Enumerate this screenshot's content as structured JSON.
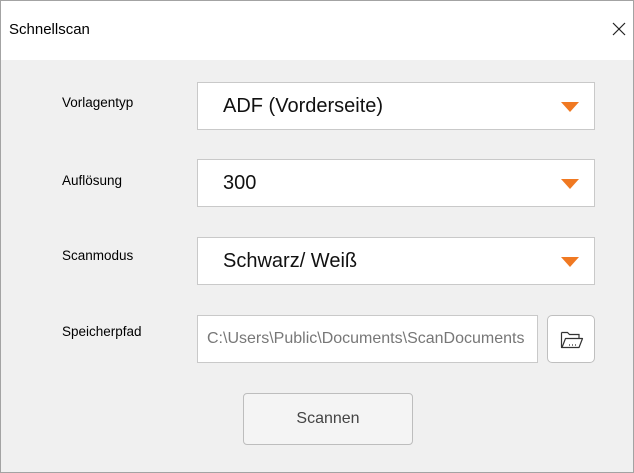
{
  "window": {
    "title": "Schnellscan",
    "close_icon": "close-icon"
  },
  "form": {
    "document_type": {
      "label": "Vorlagentyp",
      "value": "ADF (Vorderseite)"
    },
    "resolution": {
      "label": "Auflösung",
      "value": "300"
    },
    "scan_mode": {
      "label": "Scanmodus",
      "value": "Schwarz/ Weiß"
    },
    "save_path": {
      "label": "Speicherpfad",
      "value": "C:\\Users\\Public\\Documents\\ScanDocuments"
    },
    "browse_icon": "folder-open-icon"
  },
  "actions": {
    "scan_label": "Scannen"
  },
  "colors": {
    "dropdown_arrow": "#f07922",
    "dialog_background": "#f0f0f0"
  }
}
